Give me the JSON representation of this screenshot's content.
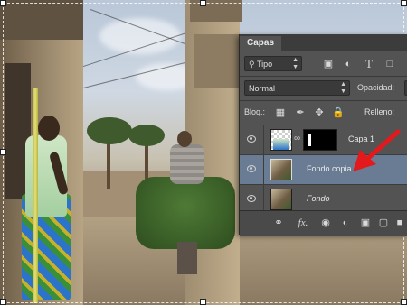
{
  "panel": {
    "tab_label": "Capas",
    "filter": {
      "value": "Tipo",
      "icons": [
        "image-filter-icon",
        "adjustment-filter-icon",
        "text-filter-icon",
        "shape-filter-icon"
      ]
    },
    "blend_mode": "Normal",
    "opacity_label": "Opacidad:",
    "lock_label": "Bloq.:",
    "fill_label": "Relleno:",
    "layers": [
      {
        "name": "Capa 1",
        "selected": false,
        "visible": true,
        "has_mask": true
      },
      {
        "name": "Fondo copia",
        "selected": true,
        "visible": true,
        "has_mask": false
      },
      {
        "name": "Fondo",
        "selected": false,
        "visible": true,
        "has_mask": false,
        "italic": true
      }
    ],
    "footer_icons": [
      "link-icon",
      "fx-icon",
      "add-mask-icon",
      "adjustment-layer-icon",
      "new-group-icon",
      "new-layer-icon",
      "trash-icon"
    ],
    "fx_label": "fx."
  },
  "annotation": {
    "arrow_color": "#e3191b"
  }
}
